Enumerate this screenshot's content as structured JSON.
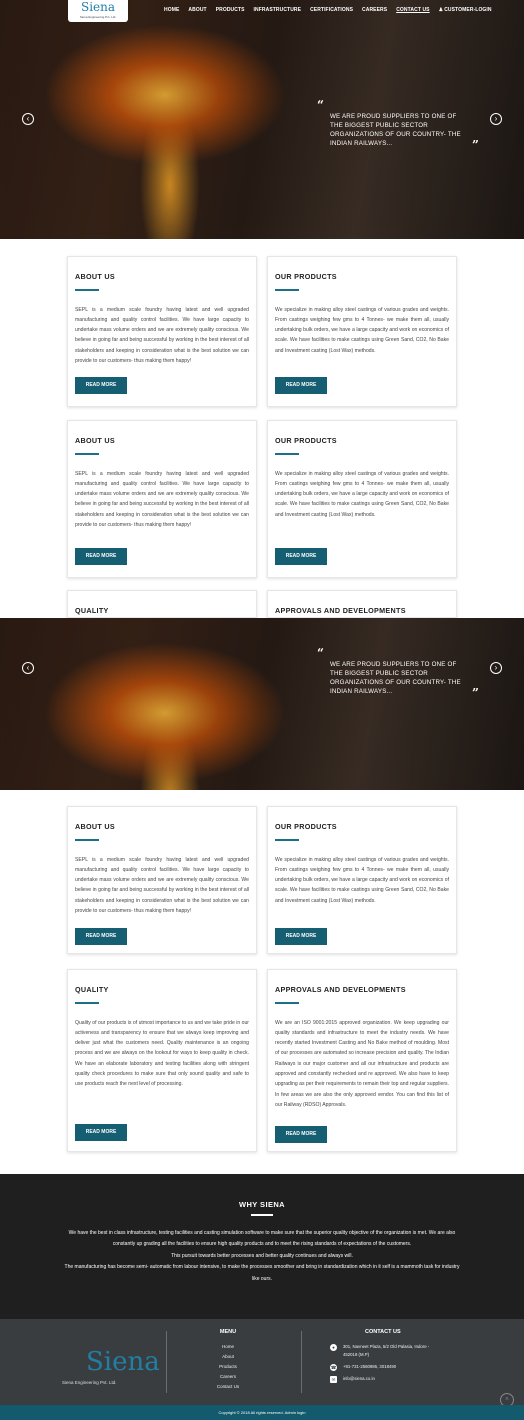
{
  "nav": {
    "logo_text": "Siena",
    "logo_sub": "Siena Engineering Pvt. Ltd.",
    "items": [
      "HOME",
      "ABOUT",
      "PRODUCTS",
      "INFRASTRUCTURE",
      "CERTIFICATIONS",
      "CAREERS",
      "CONTACT US",
      "CUSTOMER-LOGIN"
    ]
  },
  "hero": {
    "quote": "WE ARE PROUD SUPPLIERS TO ONE OF THE BIGGEST PUBLIC SECTOR ORGANIZATIONS OF OUR COUNTRY- THE INDIAN RAILWAYS...",
    "open_quote": "“",
    "close_quote": "”",
    "prev_arrow": "‹",
    "next_arrow": "›"
  },
  "cards": {
    "about": {
      "title": "ABOUT US",
      "text": "SEPL is a medium scale foundry having latest and well upgraded manufacturing and quality control facilities. We have large capacity to undertake mass volume orders and we are extremely quality conscious. We believe in going far and being successful by working in the best interest of all stakeholders and keeping in consideration what is the best solution we can provide to our customers- thus making them happy!",
      "button": "READ MORE"
    },
    "products": {
      "title": "OUR PRODUCTS",
      "text": "We specialize in making alloy steel castings of various grades and weights. From castings weighing few gms to 4 Tonnes- we make them all, usually undertaking bulk orders, we have a large capacity and work on economics of scale. We have facilities to make castings using Green Sand, CO2, No Bake and Investment casting (Lost Wax) methods.",
      "button": "READ MORE"
    },
    "quality": {
      "title": "QUALITY",
      "text": "Quality of our products is of utmost importance to us and we take pride in our activeness and transparency to ensure that we always keep improving and deliver just what the customers need. Quality maintenance is an ongoing process and we are always on the lookout for ways to keep quality in check. We have an elaborate laboratory and testing facilities along with stringent quality check procedures to make sure that only sound quality and safe to use products reach the next level of processing.",
      "button": "READ MORE"
    },
    "approvals": {
      "title": "APPROVALS AND DEVELOPMENTS",
      "text": "We are an ISO 9001:2015 approved organization. We keep upgrading our quality standards and infrastructure to meet the industry needs. We have recently started Investment Casting and No Bake method of moulding. Most of our processes are automated so increase precision and quality. The Indian Railways is our major customer and all our infrastructure and products are approved and constantly rechecked and re approved. We also have to keep upgrading as per their requirements to remain their top and regular suppliers. In few areas we are also the only approved vendor. You can find this list of our Railway (RDSO) Approvals.",
      "button": "READ MORE"
    }
  },
  "why": {
    "title": "WHY SIENA",
    "p1": "We have the best in class infrastructure, testing facilities and casting simulation software to make sure that the superior quality objective of the organization is met. We are also constantly up grading all the facilities to ensure high quality products and to meet the rising standards of expectations of the customers.",
    "p2": "This pursuit towards better processes and better quality continues and always will.",
    "p3": "The manufacturing has become semi- automatic from labour intensive, to make the processes smoother and bring in standardization which in it self is a mammoth task for industry like ours."
  },
  "footer": {
    "logo_text": "Siena",
    "company": "Siena Engineering Pvt. Ltd.",
    "menu_title": "MENU",
    "menu": [
      "Home",
      "About",
      "Products",
      "Careers",
      "Contact Us"
    ],
    "contact_title": "CONTACT US",
    "address": "301, Navneet Plaza, 5/2 Old Palasia, Indore - 452018 (M.P)",
    "phone": "+91-731-2560986, 3018490",
    "email": "info@siena.co.in",
    "copyright": "Copyright © 2018 All rights reserved. Admin login",
    "totop": "˄"
  },
  "colors": {
    "accent": "#165e72",
    "dark": "#1f1f1f",
    "footer": "#3a3d40"
  }
}
